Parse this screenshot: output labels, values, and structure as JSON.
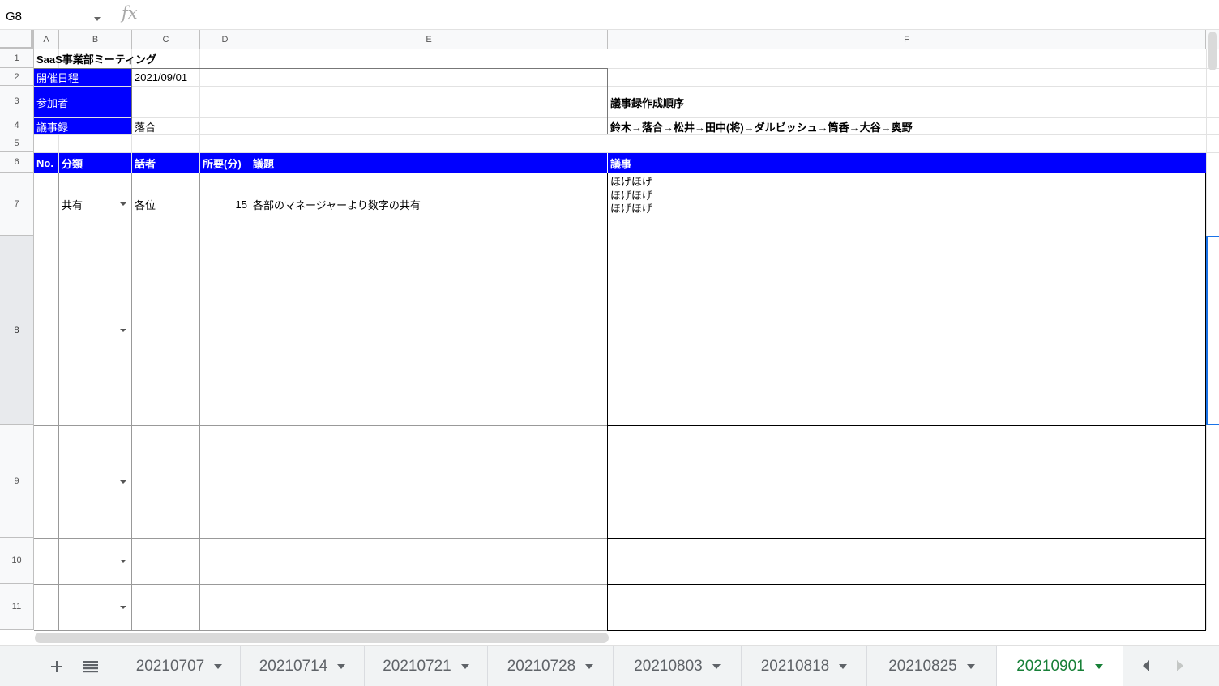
{
  "formula_bar": {
    "cell_ref": "G8",
    "fx_label": "fx",
    "formula": ""
  },
  "columns": [
    "A",
    "B",
    "C",
    "D",
    "E",
    "F"
  ],
  "rows": [
    "1",
    "2",
    "3",
    "4",
    "5",
    "6",
    "7",
    "8",
    "9",
    "10",
    "11"
  ],
  "cells": {
    "title": "SaaS事業部ミーティング",
    "date_label": "開催日程",
    "date_value": "2021/09/01",
    "participants_label": "参加者",
    "participants_value": "",
    "minutes_label": "議事録",
    "minutes_value": "落合",
    "order_label": "議事録作成順序",
    "order_value": "鈴木→落合→松井→田中(将)→ダルビッシュ→筒香→大谷→奥野",
    "header_no": "No.",
    "header_category": "分類",
    "header_speaker": "話者",
    "header_minutes": "所要(分)",
    "header_topic": "議題",
    "header_notes": "議事",
    "r7_category": "共有",
    "r7_speaker": "各位",
    "r7_minutes": "15",
    "r7_topic": "各部のマネージャーより数字の共有",
    "r7_notes": "ほげほげ\nほげほげ\nほげほげ"
  },
  "colors": {
    "header_blue": "#0000ff",
    "active_tab": "#188038",
    "selection": "#1a73e8"
  },
  "sheet_tabs": {
    "add_icon": "plus-icon",
    "all_sheets_icon": "menu-icon",
    "tabs": [
      "20210707",
      "20210714",
      "20210721",
      "20210728",
      "20210803",
      "20210818",
      "20210825",
      "20210901"
    ],
    "active": "20210901"
  }
}
